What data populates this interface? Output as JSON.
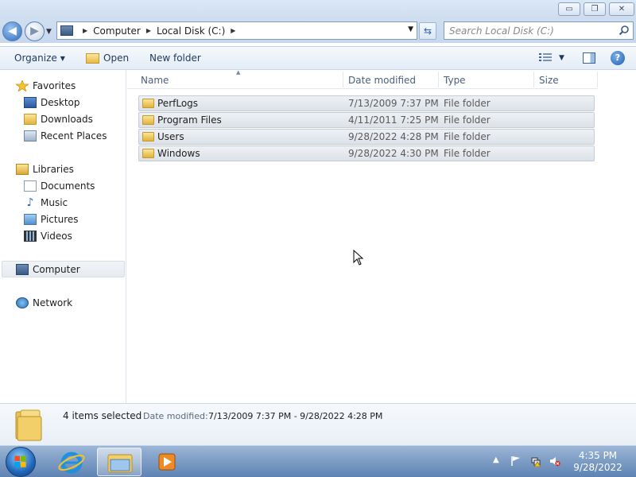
{
  "window": {
    "controls": {
      "minimize": "▭",
      "maximize": "❐",
      "close": "✕"
    }
  },
  "address": {
    "crumbs": [
      "Computer",
      "Local Disk (C:)"
    ],
    "search_placeholder": "Search Local Disk (C:)"
  },
  "toolbar": {
    "organize": "Organize",
    "open": "Open",
    "new_folder": "New folder",
    "help": "?"
  },
  "nav": {
    "favorites": {
      "label": "Favorites",
      "items": [
        "Desktop",
        "Downloads",
        "Recent Places"
      ]
    },
    "libraries": {
      "label": "Libraries",
      "items": [
        "Documents",
        "Music",
        "Pictures",
        "Videos"
      ]
    },
    "computer": "Computer",
    "network": "Network"
  },
  "columns": {
    "name": "Name",
    "date_modified": "Date modified",
    "type": "Type",
    "size": "Size"
  },
  "files": [
    {
      "name": "PerfLogs",
      "date": "7/13/2009 7:37 PM",
      "type": "File folder",
      "size": ""
    },
    {
      "name": "Program Files",
      "date": "4/11/2011 7:25 PM",
      "type": "File folder",
      "size": ""
    },
    {
      "name": "Users",
      "date": "9/28/2022 4:28 PM",
      "type": "File folder",
      "size": ""
    },
    {
      "name": "Windows",
      "date": "9/28/2022 4:30 PM",
      "type": "File folder",
      "size": ""
    }
  ],
  "details": {
    "selection": "4 items selected",
    "date_label": "Date modified:",
    "date_range": "7/13/2009 7:37 PM - 9/28/2022 4:28 PM"
  },
  "taskbar": {
    "time": "4:35 PM",
    "date": "9/28/2022"
  }
}
